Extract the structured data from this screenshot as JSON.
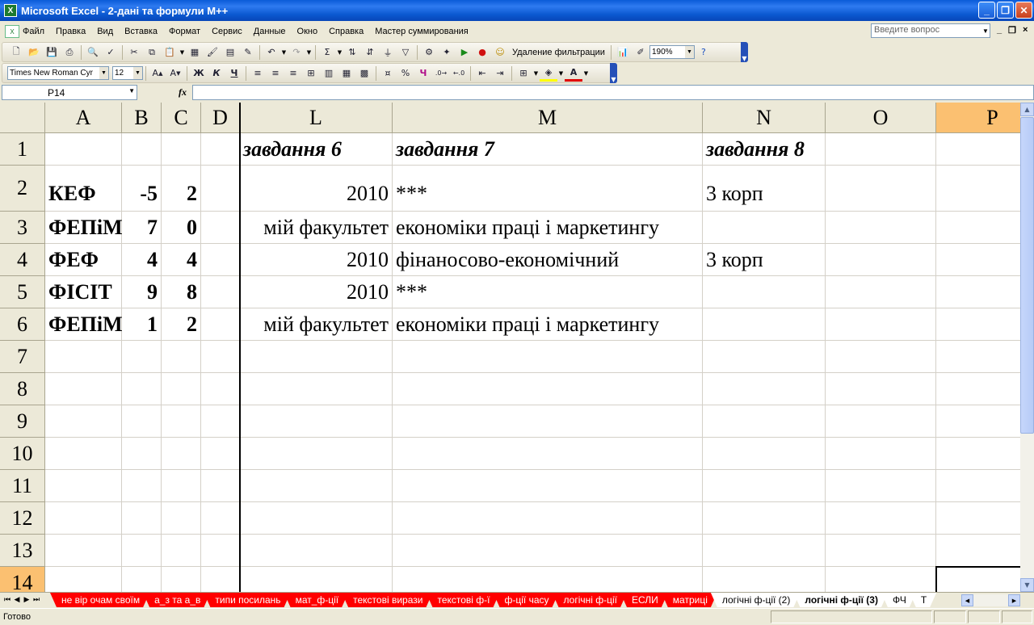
{
  "window": {
    "title": "Microsoft Excel - 2-дані та формули М++",
    "app_icon": "excel-icon",
    "controls": [
      "minimize-icon",
      "restore-icon",
      "close-icon"
    ]
  },
  "menu": {
    "items": [
      "Файл",
      "Правка",
      "Вид",
      "Вставка",
      "Формат",
      "Сервис",
      "Данные",
      "Окно",
      "Справка",
      "Мастер суммирования"
    ],
    "help_placeholder": "Введите вопрос"
  },
  "toolbar1": {
    "filter_label": "Удаление фильтрации",
    "zoom": "190%"
  },
  "toolbar2": {
    "font_name": "Times New Roman Cyr",
    "font_size": "12",
    "bold": "Ж",
    "italic": "К",
    "underline": "Ч",
    "percent": "%"
  },
  "formula_bar": {
    "name_box": "P14",
    "fx_label": "fx",
    "formula": ""
  },
  "sheet": {
    "columns": [
      "A",
      "B",
      "C",
      "D",
      "L",
      "M",
      "N",
      "O",
      "P"
    ],
    "selected_column": "P",
    "rows": [
      "1",
      "2",
      "3",
      "4",
      "5",
      "6",
      "7",
      "8",
      "9",
      "10",
      "11",
      "12",
      "13",
      "14"
    ],
    "selected_row": "14",
    "active_cell": "P14",
    "data": {
      "r1": {
        "L": "завдання 6",
        "M": "завдання 7",
        "N": "завдання 8"
      },
      "r2": {
        "A": "КЕФ",
        "B": "-5",
        "C": "2",
        "L": "2010",
        "M": "***",
        "N": "3 корп"
      },
      "r3": {
        "A": "ФЕПіМ",
        "B": "7",
        "C": "0",
        "L": "мій факультет",
        "M": "економіки праці і маркетингу"
      },
      "r4": {
        "A": "ФЕФ",
        "B": "4",
        "C": "4",
        "L": "2010",
        "M": "фінаносово-економічний",
        "N": "3 корп"
      },
      "r5": {
        "A": "ФІСІТ",
        "B": "9",
        "C": "8",
        "L": "2010",
        "M": "***"
      },
      "r6": {
        "A": "ФЕПіМ",
        "B": "1",
        "C": "2",
        "L": "мій факультет",
        "M": "економіки праці і маркетингу"
      }
    }
  },
  "sheet_tabs": {
    "tabs": [
      {
        "label": "не вір очам своїм",
        "style": "red"
      },
      {
        "label": "а_з та а_в",
        "style": "red"
      },
      {
        "label": "типи посилань",
        "style": "red"
      },
      {
        "label": "мат_ф-ції",
        "style": "red"
      },
      {
        "label": "текстові вирази",
        "style": "red"
      },
      {
        "label": "текстові ф-ї",
        "style": "red"
      },
      {
        "label": "ф-ції часу",
        "style": "red"
      },
      {
        "label": "логічні ф-ції",
        "style": "red"
      },
      {
        "label": "ЕСЛИ",
        "style": "red"
      },
      {
        "label": "матриці",
        "style": "red"
      },
      {
        "label": "логічні ф-ції (2)",
        "style": "norm"
      },
      {
        "label": "логічні ф-ції (3)",
        "style": "active"
      },
      {
        "label": "ФЧ",
        "style": "norm"
      },
      {
        "label": "Т",
        "style": "norm"
      }
    ]
  },
  "status": {
    "text": "Готово"
  }
}
